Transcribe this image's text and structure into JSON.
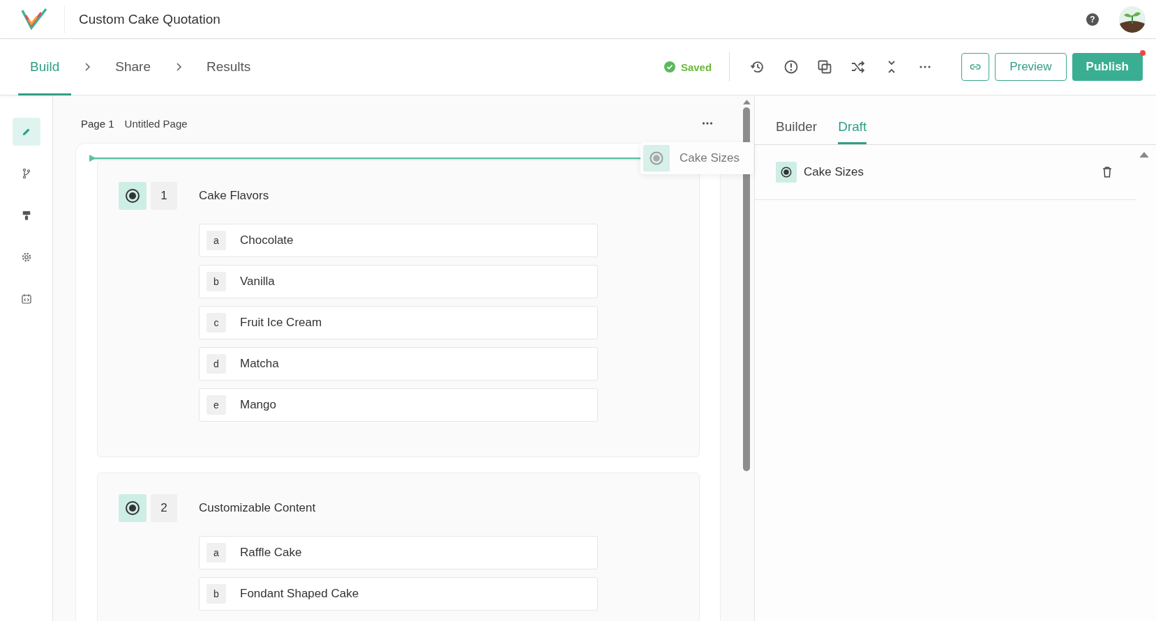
{
  "header": {
    "title": "Custom Cake Quotation",
    "help": "?"
  },
  "steps": [
    {
      "label": "Build",
      "selected": true
    },
    {
      "label": "Share",
      "selected": false
    },
    {
      "label": "Results",
      "selected": false
    }
  ],
  "save_status": "Saved",
  "actions": {
    "preview": "Preview",
    "publish": "Publish",
    "publish_notification": true
  },
  "rail": [
    {
      "kind": "pencil",
      "selected": true
    },
    {
      "kind": "branch",
      "selected": false
    },
    {
      "kind": "roller",
      "selected": false
    },
    {
      "kind": "gear",
      "selected": false
    },
    {
      "kind": "code",
      "selected": false
    }
  ],
  "page": {
    "number": "Page 1",
    "name": "Untitled Page"
  },
  "questions": [
    {
      "number": "1",
      "title": "Cake Flavors",
      "options": [
        {
          "letter": "a",
          "text": "Chocolate"
        },
        {
          "letter": "b",
          "text": "Vanilla"
        },
        {
          "letter": "c",
          "text": "Fruit Ice Cream"
        },
        {
          "letter": "d",
          "text": "Matcha"
        },
        {
          "letter": "e",
          "text": "Mango"
        }
      ]
    },
    {
      "number": "2",
      "title": "Customizable Content",
      "options": [
        {
          "letter": "a",
          "text": "Raffle Cake"
        },
        {
          "letter": "b",
          "text": "Fondant Shaped Cake"
        }
      ]
    }
  ],
  "drag_ghost": {
    "label": "Cake Sizes"
  },
  "panel": {
    "tabs": [
      {
        "label": "Builder",
        "selected": false
      },
      {
        "label": "Draft",
        "selected": true
      }
    ],
    "items": [
      {
        "label": "Cake Sizes"
      }
    ]
  }
}
